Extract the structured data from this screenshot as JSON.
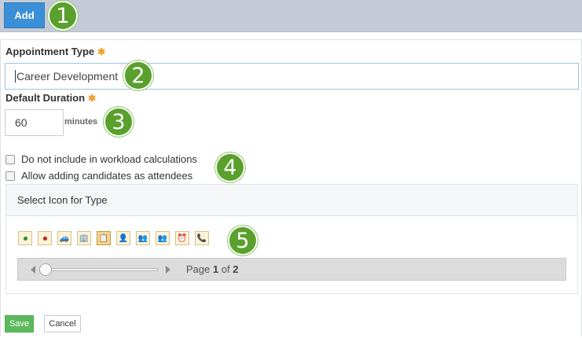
{
  "toolbar": {
    "add_label": "Add"
  },
  "callouts": [
    "1",
    "2",
    "3",
    "4",
    "5"
  ],
  "appointment_type": {
    "label": "Appointment Type",
    "required_marker": "✱",
    "value": "Career Development"
  },
  "default_duration": {
    "label": "Default Duration",
    "required_marker": "✱",
    "value": "60",
    "unit": "minutes"
  },
  "options": [
    {
      "label": "Do not include in workload calculations",
      "checked": false
    },
    {
      "label": "Allow adding candidates as attendees",
      "checked": false
    }
  ],
  "icon_picker": {
    "heading": "Select Icon for Type",
    "icons": [
      {
        "name": "green-dot-icon",
        "glyph": "",
        "selected": false
      },
      {
        "name": "red-dot-icon",
        "glyph": "",
        "selected": false
      },
      {
        "name": "car-icon",
        "glyph": "🚙",
        "selected": false
      },
      {
        "name": "building-icon",
        "glyph": "🏢",
        "selected": false
      },
      {
        "name": "presentation-icon",
        "glyph": "📋",
        "selected": true
      },
      {
        "name": "interview-icon",
        "glyph": "👤",
        "selected": false
      },
      {
        "name": "group-meeting-icon",
        "glyph": "👥",
        "selected": false
      },
      {
        "name": "team-icon",
        "glyph": "👥",
        "selected": false
      },
      {
        "name": "clock-icon",
        "glyph": "⏰",
        "selected": false
      },
      {
        "name": "phone-call-icon",
        "glyph": "📞",
        "selected": false
      }
    ],
    "pager": {
      "prefix": "Page",
      "current": "1",
      "separator": "of",
      "total": "2"
    }
  },
  "actions": {
    "save_label": "Save",
    "cancel_label": "Cancel"
  },
  "colors": {
    "primary": "#3a8fd6",
    "success": "#5cb85c",
    "callout": "#5aa02c",
    "required": "#f0a030"
  }
}
